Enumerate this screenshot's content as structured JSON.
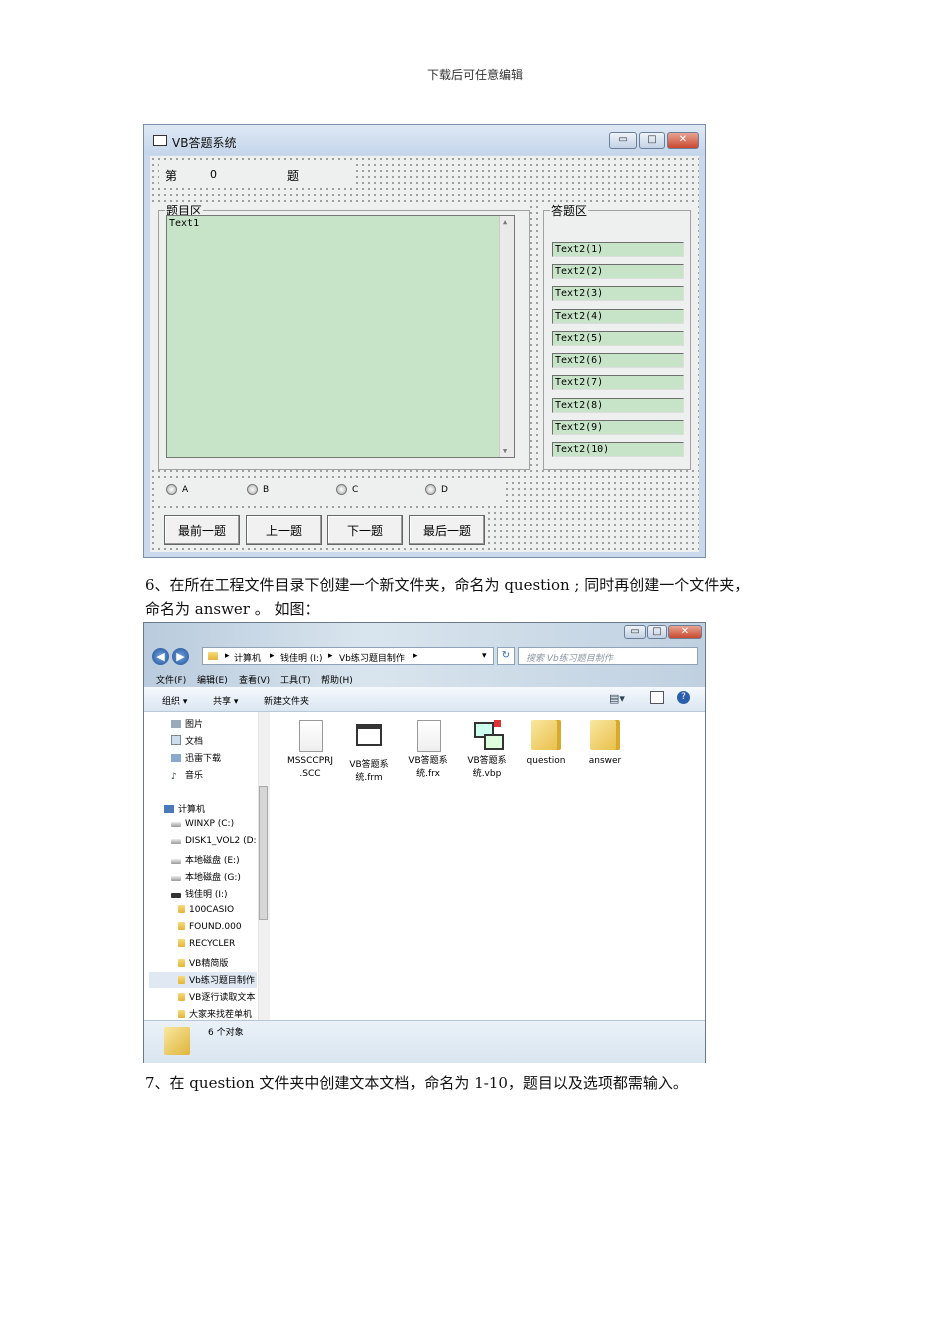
{
  "page_header": "下载后可任意编辑",
  "vb_window": {
    "title": "VB答题系统",
    "min_btn": "▭",
    "max_btn": "□",
    "close_btn": "✕",
    "q_prefix": "第",
    "q_number": "0",
    "q_suffix": "题",
    "question_group": "题目区",
    "question_text": "Text1",
    "answer_group": "答题区",
    "answer_boxes": [
      "Text2(1)",
      "Text2(2)",
      "Text2(3)",
      "Text2(4)",
      "Text2(5)",
      "Text2(6)",
      "Text2(7)",
      "Text2(8)",
      "Text2(9)",
      "Text2(10)"
    ],
    "options": [
      "A",
      "B",
      "C",
      "D"
    ],
    "buttons": [
      "最前一题",
      "上一题",
      "下一题",
      "最后一题"
    ]
  },
  "para_6_line1": "6、在所在工程文件目录下创建一个新文件夹，命名为 question ; 同时再创建一个文件夹，",
  "para_6_line2": "命名为 answer 。 如图：",
  "explorer": {
    "title_min": "▭",
    "title_max": "□",
    "title_close": "✕",
    "back": "◀",
    "forward": "▶",
    "path": [
      "计算机",
      "钱佳明 (I:)",
      "Vb练习题目制作"
    ],
    "refresh": "↻",
    "search_placeholder": "搜索 Vb练习题目制作",
    "menu": [
      "文件(F)",
      "编辑(E)",
      "查看(V)",
      "工具(T)",
      "帮助(H)"
    ],
    "commands": [
      "组织 ▾",
      "共享 ▾",
      "新建文件夹"
    ],
    "nav_items": [
      "图片",
      "文档",
      "迅雷下载",
      "音乐",
      "计算机",
      "WINXP (C:)",
      "DISK1_VOL2 (D:",
      "本地磁盘 (E:)",
      "本地磁盘 (G:)",
      "钱佳明 (I:)",
      "100CASIO",
      "FOUND.000",
      "RECYCLER",
      "VB精简版",
      "Vb练习题目制作",
      "VB逐行读取文本",
      "大家来找茬单机"
    ],
    "files": [
      {
        "name1": "MSSCCPRJ",
        "name2": ".SCC",
        "kind": "doc"
      },
      {
        "name1": "VB答题系",
        "name2": "统.frm",
        "kind": "form"
      },
      {
        "name1": "VB答题系",
        "name2": "统.frx",
        "kind": "doc"
      },
      {
        "name1": "VB答题系",
        "name2": "统.vbp",
        "kind": "project"
      },
      {
        "name1": "question",
        "name2": "",
        "kind": "folder"
      },
      {
        "name1": "answer",
        "name2": "",
        "kind": "folder"
      }
    ],
    "status": "6 个对象"
  },
  "para_7": "7、在 question 文件夹中创建文本文档，命名为 1-10，题目以及选项都需输入。"
}
